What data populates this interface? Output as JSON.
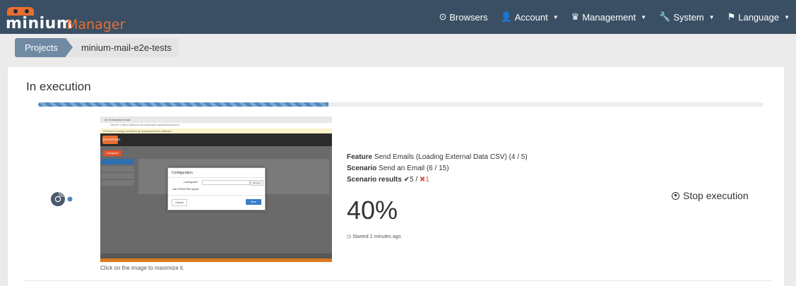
{
  "navbar": {
    "brand_minium": "minium",
    "brand_manager": "Manager",
    "items": [
      {
        "icon": "play-circle-icon",
        "label": "Browsers",
        "dropdown": false
      },
      {
        "icon": "user-icon",
        "label": "Account",
        "dropdown": true
      },
      {
        "icon": "king-icon",
        "label": "Management",
        "dropdown": true
      },
      {
        "icon": "wrench-icon",
        "label": "System",
        "dropdown": true
      },
      {
        "icon": "flag-icon",
        "label": "Language",
        "dropdown": true
      }
    ]
  },
  "breadcrumb": {
    "projects": "Projects",
    "current": "minium-mail-e2e-tests"
  },
  "execution": {
    "title": "In execution",
    "progress_fraction": 0.4,
    "browser_icon": "chrome-icon",
    "screenshot": {
      "tab_title": "ee: Enterprise Email",
      "url": "Secure | https://minium.vilt.io/sample-app/#/inbox/inbox",
      "info_bar": "Chrome is being controlled by automated test software.",
      "app_logo": "ENTERPRISE",
      "compose": "Compose",
      "dialog_title": "Configuration",
      "dialog_loading_row": "Loading time",
      "dialog_use_html5": "Use HTML5 File Upload",
      "dialog_browse": "Browse",
      "dialog_cancel": "Cancel",
      "dialog_save": "Save"
    },
    "caption": "Click on the image to maximize it.",
    "feature_label": "Feature",
    "feature_value": "Send Emails (Loading External Data CSV) (4 / 5)",
    "scenario_label": "Scenario",
    "scenario_value": "Send an Email (6 / 15)",
    "results_label": "Scenario results",
    "results_passed": "5",
    "results_separator": "/",
    "results_failed": "1",
    "percent": "40%",
    "started": "Started 2 minutes ago",
    "stop_label": "Stop execution"
  }
}
